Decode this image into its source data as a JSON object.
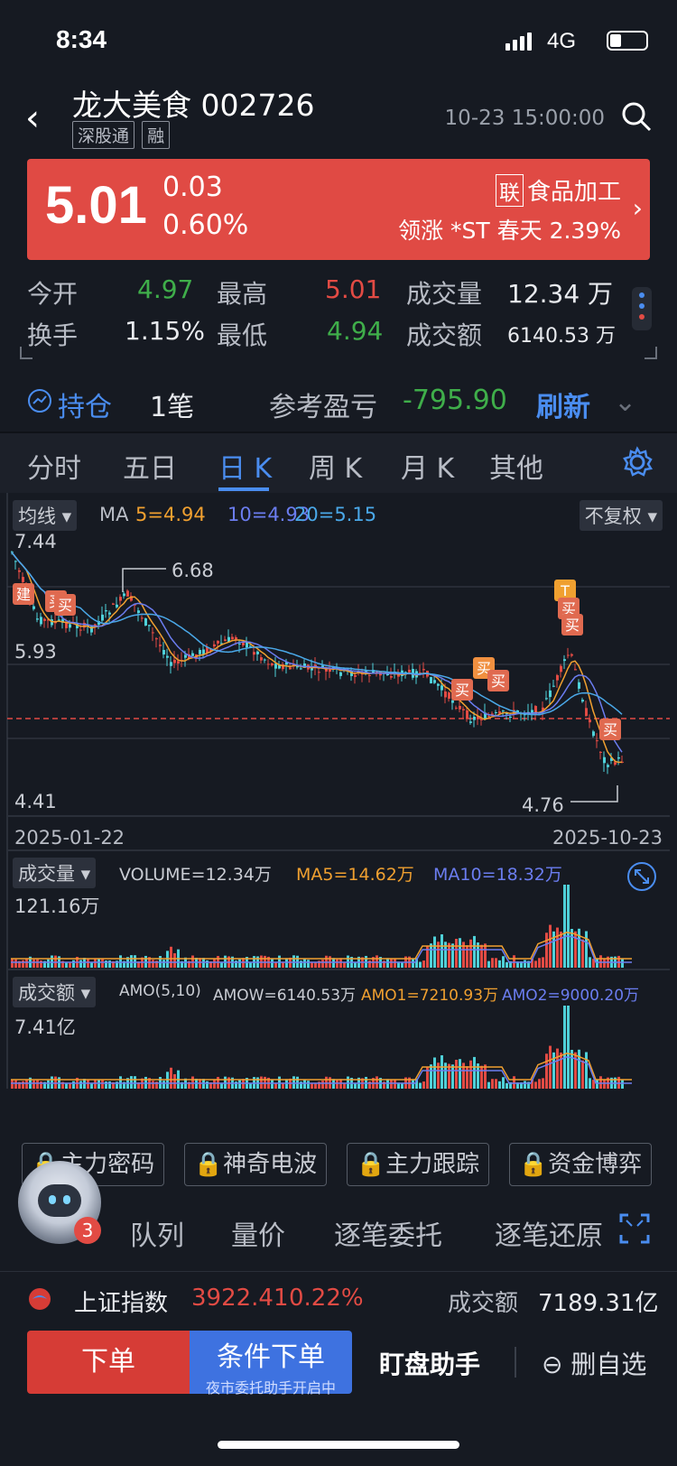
{
  "status_bar": {
    "time": "8:34",
    "network": "4G"
  },
  "header": {
    "title": "龙大美食 002726",
    "tags": [
      "深股通",
      "融"
    ],
    "datetime": "10-23 15:00:00"
  },
  "quote": {
    "price": "5.01",
    "change": "0.03",
    "change_pct": "0.60%",
    "industry_badge": "联",
    "industry": "食品加工",
    "leader": "领涨 *ST 春天 2.39%"
  },
  "stats": {
    "open_label": "今开",
    "open": "4.97",
    "high_label": "最高",
    "high": "5.01",
    "volume_label": "成交量",
    "volume": "12.34 万",
    "turnover_label": "换手",
    "turnover": "1.15%",
    "low_label": "最低",
    "low": "4.94",
    "amount_label": "成交额",
    "amount": "6140.53 万"
  },
  "holding": {
    "label": "持仓",
    "count": "1笔",
    "pl_label": "参考盈亏",
    "pl": "-795.90",
    "refresh": "刷新"
  },
  "tabs": [
    "分时",
    "五日",
    "日 K",
    "周 K",
    "月 K",
    "其他"
  ],
  "active_tab": "日 K",
  "kline": {
    "ma_selector": "均线",
    "ma_label": "MA",
    "ma5": "5=4.94",
    "ma10": "10=4.93",
    "ma20": "20=5.15",
    "adjust": "不复权",
    "y_top": "7.44",
    "y_mid": "5.93",
    "y_bottom": "4.41",
    "max_mark": "6.68",
    "min_mark": "4.76",
    "date_start": "2025-01-22",
    "date_end": "2025-10-23",
    "signals": {
      "build": "建",
      "buy": "买",
      "t": "T"
    },
    "colors": {
      "up": "#e24b44",
      "down": "#4fd1d9",
      "ma5": "#f0a030",
      "ma10": "#6b7df0",
      "ma20": "#4aa8e8"
    }
  },
  "volume_panel": {
    "selector": "成交量",
    "volume": "VOLUME=12.34万",
    "ma5": "MA5=14.62万",
    "ma10": "MA10=18.32万",
    "max": "121.16万"
  },
  "amount_panel": {
    "selector": "成交额",
    "params": "AMO(5,10)",
    "amow": "AMOW=6140.53万",
    "amo1": "AMO1=7210.93万",
    "amo2": "AMO2=9000.20万",
    "max": "7.41亿"
  },
  "locks": [
    "主力密码",
    "神奇电波",
    "主力跟踪",
    "资金博弈"
  ],
  "badge_count": "3",
  "detail_tabs": [
    "队列",
    "量价",
    "逐笔委托",
    "逐笔还原"
  ],
  "index_bar": {
    "name": "上证指数",
    "value": "3922.41",
    "pct": "0.22%",
    "amount_label": "成交额",
    "amount": "7189.31亿"
  },
  "bottom": {
    "order": "下单",
    "cond_order": "条件下单",
    "cond_sub": "夜市委托助手开启中",
    "helper": "盯盘助手",
    "remove": "删自选"
  }
}
